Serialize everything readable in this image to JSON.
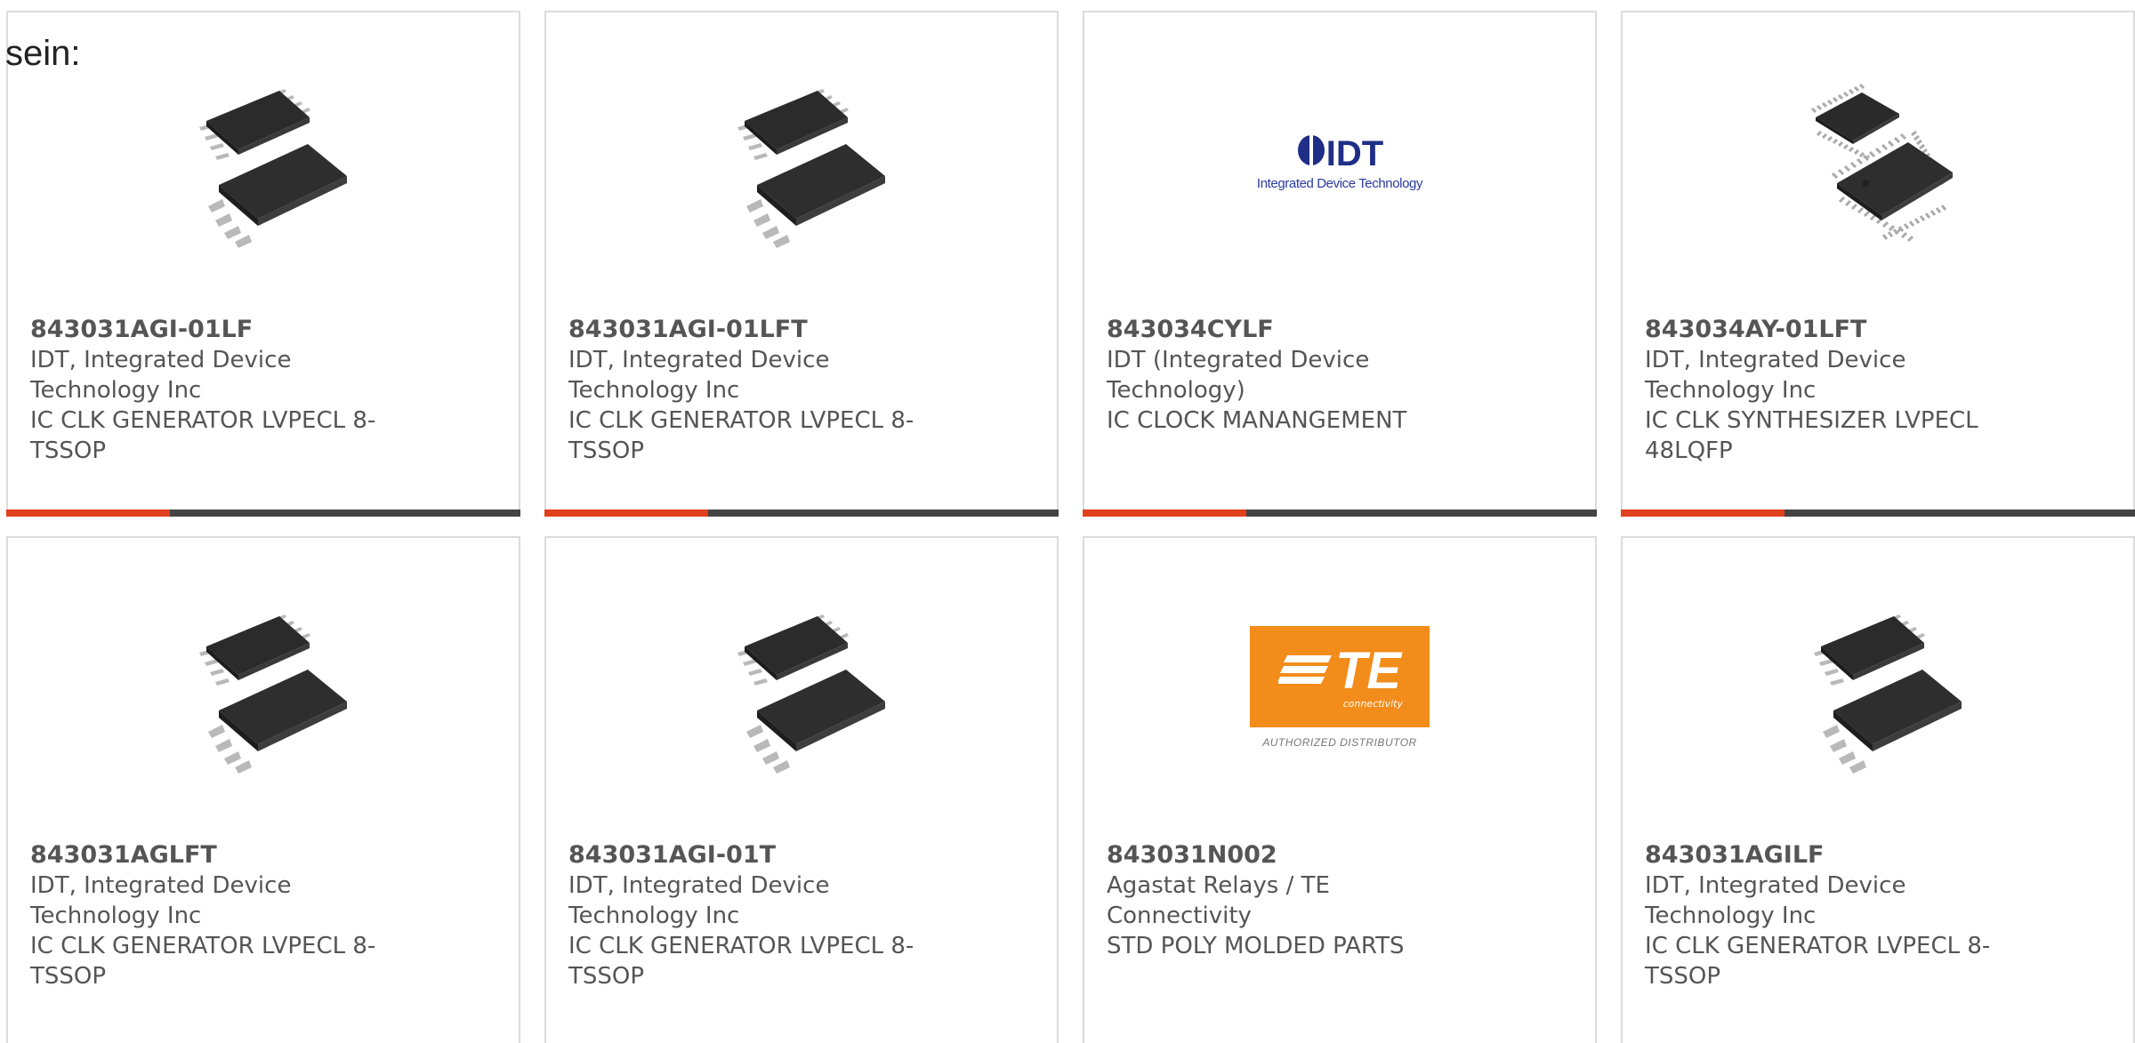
{
  "intro_text": "sein:",
  "accent_color": "#e0401b",
  "cards": [
    {
      "part": "843031AGI-01LF",
      "manufacturer_line1": "IDT, Integrated Device",
      "manufacturer_line2": "Technology Inc",
      "description_line1": "IC CLK GENERATOR LVPECL 8-",
      "description_line2": "TSSOP",
      "image": "tssop-8-chip",
      "image_alt": "843031AGI-01LF"
    },
    {
      "part": "843031AGI-01LFT",
      "manufacturer_line1": "IDT, Integrated Device",
      "manufacturer_line2": "Technology Inc",
      "description_line1": "IC CLK GENERATOR LVPECL 8-",
      "description_line2": "TSSOP",
      "image": "tssop-8-chip",
      "image_alt": "843031AGI-01LFT"
    },
    {
      "part": "843034CYLF",
      "manufacturer_line1": "IDT (Integrated Device",
      "manufacturer_line2": "Technology)",
      "description_line1": "IC CLOCK MANANGEMENT",
      "description_line2": "",
      "image": "idt-logo",
      "image_alt": "843034CYLF",
      "logo_word": "IDT",
      "logo_tagline": "Integrated Device Technology"
    },
    {
      "part": "843034AY-01LFT",
      "manufacturer_line1": "IDT, Integrated Device",
      "manufacturer_line2": "Technology Inc",
      "description_line1": "IC CLK SYNTHESIZER LVPECL",
      "description_line2": "48LQFP",
      "image": "lqfp-48-chip",
      "image_alt": "843034AY-01LFT"
    },
    {
      "part": "843031AGLFT",
      "manufacturer_line1": "IDT, Integrated Device",
      "manufacturer_line2": "Technology Inc",
      "description_line1": "IC CLK GENERATOR LVPECL 8-",
      "description_line2": "TSSOP",
      "image": "tssop-8-chip",
      "image_alt": "843031AGLFT"
    },
    {
      "part": "843031AGI-01T",
      "manufacturer_line1": "IDT, Integrated Device",
      "manufacturer_line2": "Technology Inc",
      "description_line1": "IC CLK GENERATOR LVPECL 8-",
      "description_line2": "TSSOP",
      "image": "tssop-8-chip",
      "image_alt": "843031AGI-01T"
    },
    {
      "part": "843031N002",
      "manufacturer_line1": "Agastat Relays / TE Connectivity",
      "manufacturer_line2": "",
      "description_line1": "STD POLY MOLDED PARTS",
      "description_line2": "",
      "image": "te-logo",
      "image_alt": "843031N002",
      "logo_word": "TE",
      "logo_sub": "connectivity",
      "logo_caption": "AUTHORIZED DISTRIBUTOR",
      "logo_color": "#f28c1a"
    },
    {
      "part": "843031AGILF",
      "manufacturer_line1": "IDT, Integrated Device",
      "manufacturer_line2": "Technology Inc",
      "description_line1": "IC CLK GENERATOR LVPECL 8-",
      "description_line2": "TSSOP",
      "image": "tssop-8-chip",
      "image_alt": "843031AGILF"
    }
  ]
}
